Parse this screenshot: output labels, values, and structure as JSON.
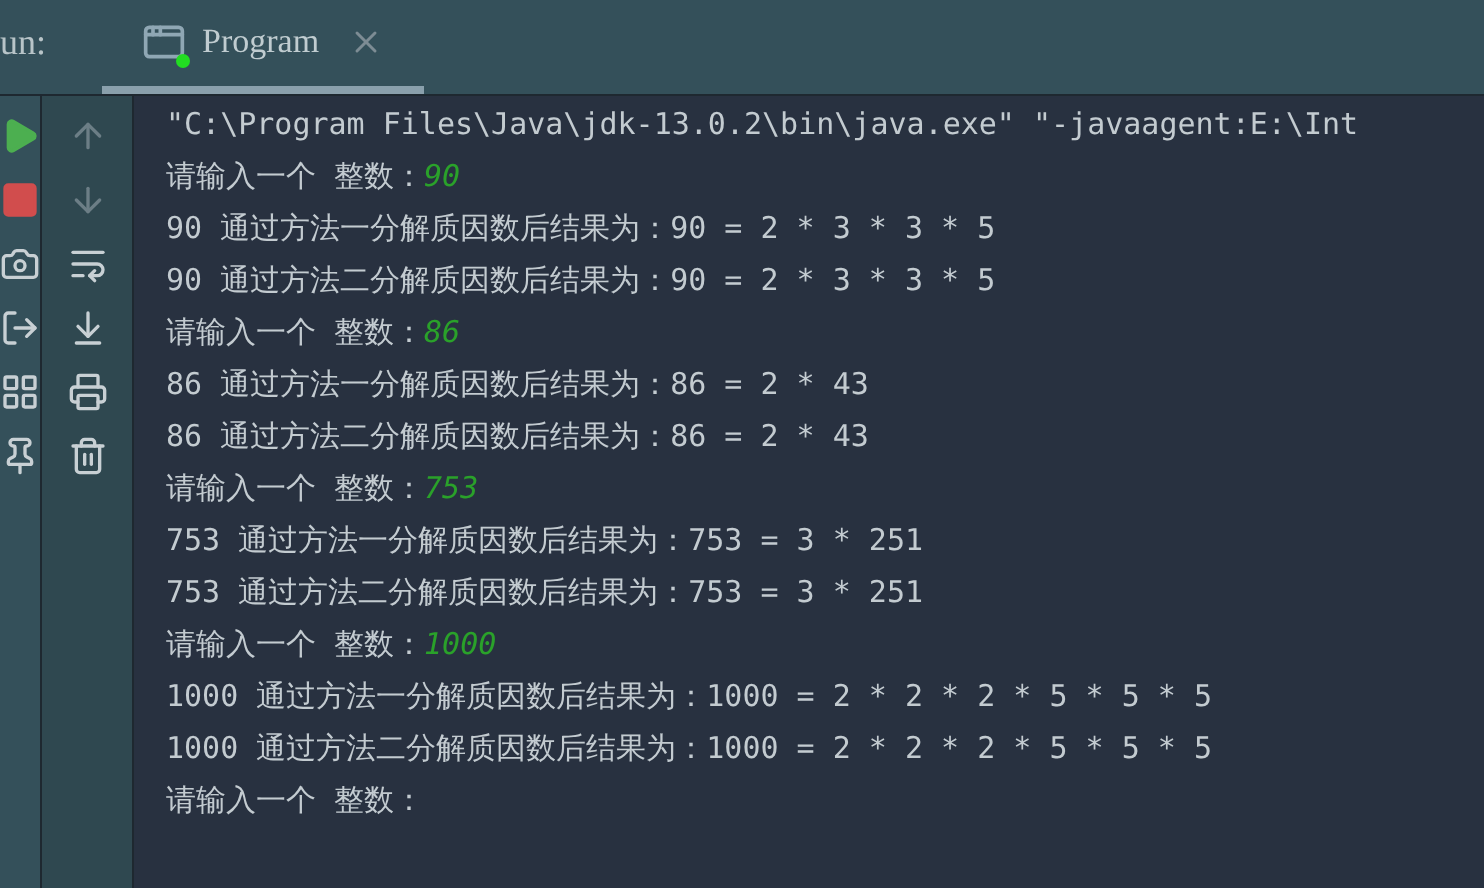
{
  "run_label": "un:",
  "tab": {
    "title": "Program",
    "selected": true
  },
  "console_lines": [
    {
      "kind": "output",
      "text": "\"C:\\Program Files\\Java\\jdk-13.0.2\\bin\\java.exe\" \"-javaagent:E:\\Int"
    },
    {
      "kind": "input",
      "text": "请输入一个 整数：",
      "value": "90"
    },
    {
      "kind": "output",
      "text": "90 通过方法一分解质因数后结果为：90 = 2 * 3 * 3 * 5"
    },
    {
      "kind": "output",
      "text": "90 通过方法二分解质因数后结果为：90 = 2 * 3 * 3 * 5"
    },
    {
      "kind": "input",
      "text": "请输入一个 整数：",
      "value": "86"
    },
    {
      "kind": "output",
      "text": "86 通过方法一分解质因数后结果为：86 = 2 * 43"
    },
    {
      "kind": "output",
      "text": "86 通过方法二分解质因数后结果为：86 = 2 * 43"
    },
    {
      "kind": "input",
      "text": "请输入一个 整数：",
      "value": "753"
    },
    {
      "kind": "output",
      "text": "753 通过方法一分解质因数后结果为：753 = 3 * 251"
    },
    {
      "kind": "output",
      "text": "753 通过方法二分解质因数后结果为：753 = 3 * 251"
    },
    {
      "kind": "input",
      "text": "请输入一个 整数：",
      "value": "1000"
    },
    {
      "kind": "output",
      "text": "1000 通过方法一分解质因数后结果为：1000 = 2 * 2 * 2 * 5 * 5 * 5"
    },
    {
      "kind": "output",
      "text": "1000 通过方法二分解质因数后结果为：1000 = 2 * 2 * 2 * 5 * 5 * 5"
    },
    {
      "kind": "input",
      "text": "请输入一个 整数："
    }
  ]
}
